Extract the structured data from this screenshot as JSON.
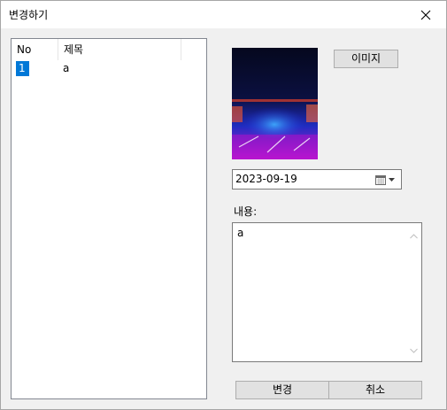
{
  "window": {
    "title": "변경하기"
  },
  "list": {
    "columns": [
      "No",
      "제목"
    ],
    "rows": [
      {
        "no": "1",
        "title": "a",
        "selected": true
      }
    ]
  },
  "image_button": "이미지",
  "thumbnail": {
    "description_icon": "photo-thumbnail"
  },
  "date": {
    "value": "2023-09-19"
  },
  "content": {
    "label": "내용:",
    "text": "a"
  },
  "buttons": {
    "change": "변경",
    "cancel": "취소"
  },
  "colors": {
    "selection": "#0078d7",
    "dialog_bg": "#f0f0f0",
    "button_bg": "#e1e1e1"
  }
}
